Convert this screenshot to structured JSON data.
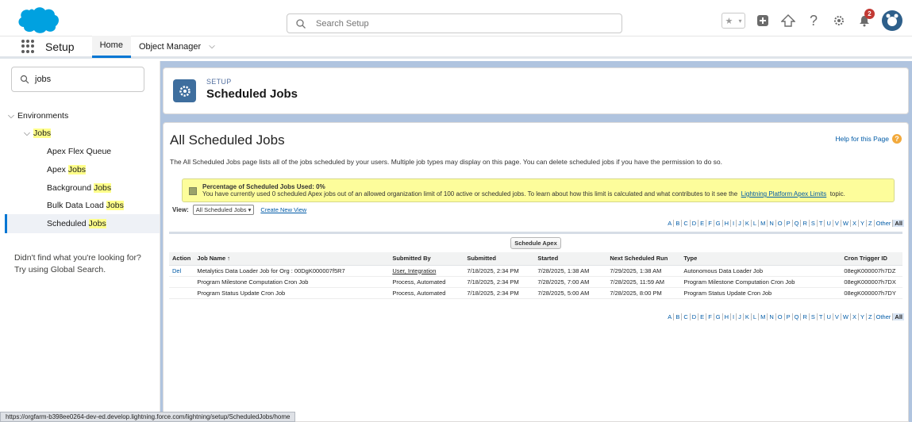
{
  "header": {
    "search_placeholder": "Search Setup",
    "notification_count": "2",
    "icons": [
      "favorites-icon",
      "add-icon",
      "trailhead-icon",
      "help-icon",
      "gear-icon",
      "bell-icon",
      "avatar-icon"
    ],
    "brand_color": "#00a1e0"
  },
  "nav": {
    "app_name": "Setup",
    "tabs": [
      {
        "label": "Home",
        "active": true
      },
      {
        "label": "Object Manager",
        "active": false
      }
    ]
  },
  "sidebar": {
    "quick_find_value": "jobs",
    "environments_label": "Environments",
    "jobs_label": "Jobs",
    "items": [
      {
        "prefix": "Apex Flex Queue",
        "hl": ""
      },
      {
        "prefix": "Apex ",
        "hl": "Jobs"
      },
      {
        "prefix": "Background ",
        "hl": "Jobs"
      },
      {
        "prefix": "Bulk Data Load ",
        "hl": "Jobs"
      },
      {
        "prefix": "Scheduled ",
        "hl": "Jobs"
      }
    ],
    "hint_line1": "Didn't find what you're looking for?",
    "hint_line2": "Try using Global Search."
  },
  "page_header": {
    "eyebrow": "SETUP",
    "title": "Scheduled Jobs"
  },
  "main": {
    "title": "All Scheduled Jobs",
    "help_link": "Help for this Page",
    "description": "The All Scheduled Jobs page lists all of the jobs scheduled by your users. Multiple job types may display on this page. You can delete scheduled jobs if you have the permission to do so.",
    "notice_title": "Percentage of Scheduled Jobs Used: 0%",
    "notice_text": "You have currently used 0 scheduled Apex jobs out of an allowed organization limit of 100 active or scheduled jobs. To learn about how this limit is calculated and what contributes to it see the",
    "notice_link": "Lightning Platform Apex Limits",
    "notice_suffix": "topic.",
    "view_label": "View:",
    "view_value": "All Scheduled Jobs",
    "create_view": "Create New View",
    "schedule_button": "Schedule Apex"
  },
  "alphabet": [
    "A",
    "B",
    "C",
    "D",
    "E",
    "F",
    "G",
    "H",
    "I",
    "J",
    "K",
    "L",
    "M",
    "N",
    "O",
    "P",
    "Q",
    "R",
    "S",
    "T",
    "U",
    "V",
    "W",
    "X",
    "Y",
    "Z",
    "Other",
    "All"
  ],
  "table": {
    "columns": [
      "Action",
      "Job Name ↑",
      "Submitted By",
      "Submitted",
      "Started",
      "Next Scheduled Run",
      "Type",
      "Cron Trigger ID"
    ],
    "rows": [
      [
        "Del",
        "Metalytics Data Loader Job for Org : 00DgK000007f5R7",
        "User, Integration",
        "7/18/2025, 2:34 PM",
        "7/28/2025, 1:38 AM",
        "7/29/2025, 1:38 AM",
        "Autonomous Data Loader Job",
        "08egK000007h7DZ"
      ],
      [
        "",
        "Program Milestone Computation Cron Job",
        "Process, Automated",
        "7/18/2025, 2:34 PM",
        "7/28/2025, 7:00 AM",
        "7/28/2025, 11:59 AM",
        "Program Milestone Computation Cron Job",
        "08egK000007h7DX"
      ],
      [
        "",
        "Program Status Update Cron Job",
        "Process, Automated",
        "7/18/2025, 2:34 PM",
        "7/28/2025, 5:00 AM",
        "7/28/2025, 8:00 PM",
        "Program Status Update Cron Job",
        "08egK000007h7DY"
      ]
    ]
  },
  "status_url": "https://orgfarm-b398ee0264-dev-ed.develop.lightning.force.com/lightning/setup/ScheduledJobs/home"
}
